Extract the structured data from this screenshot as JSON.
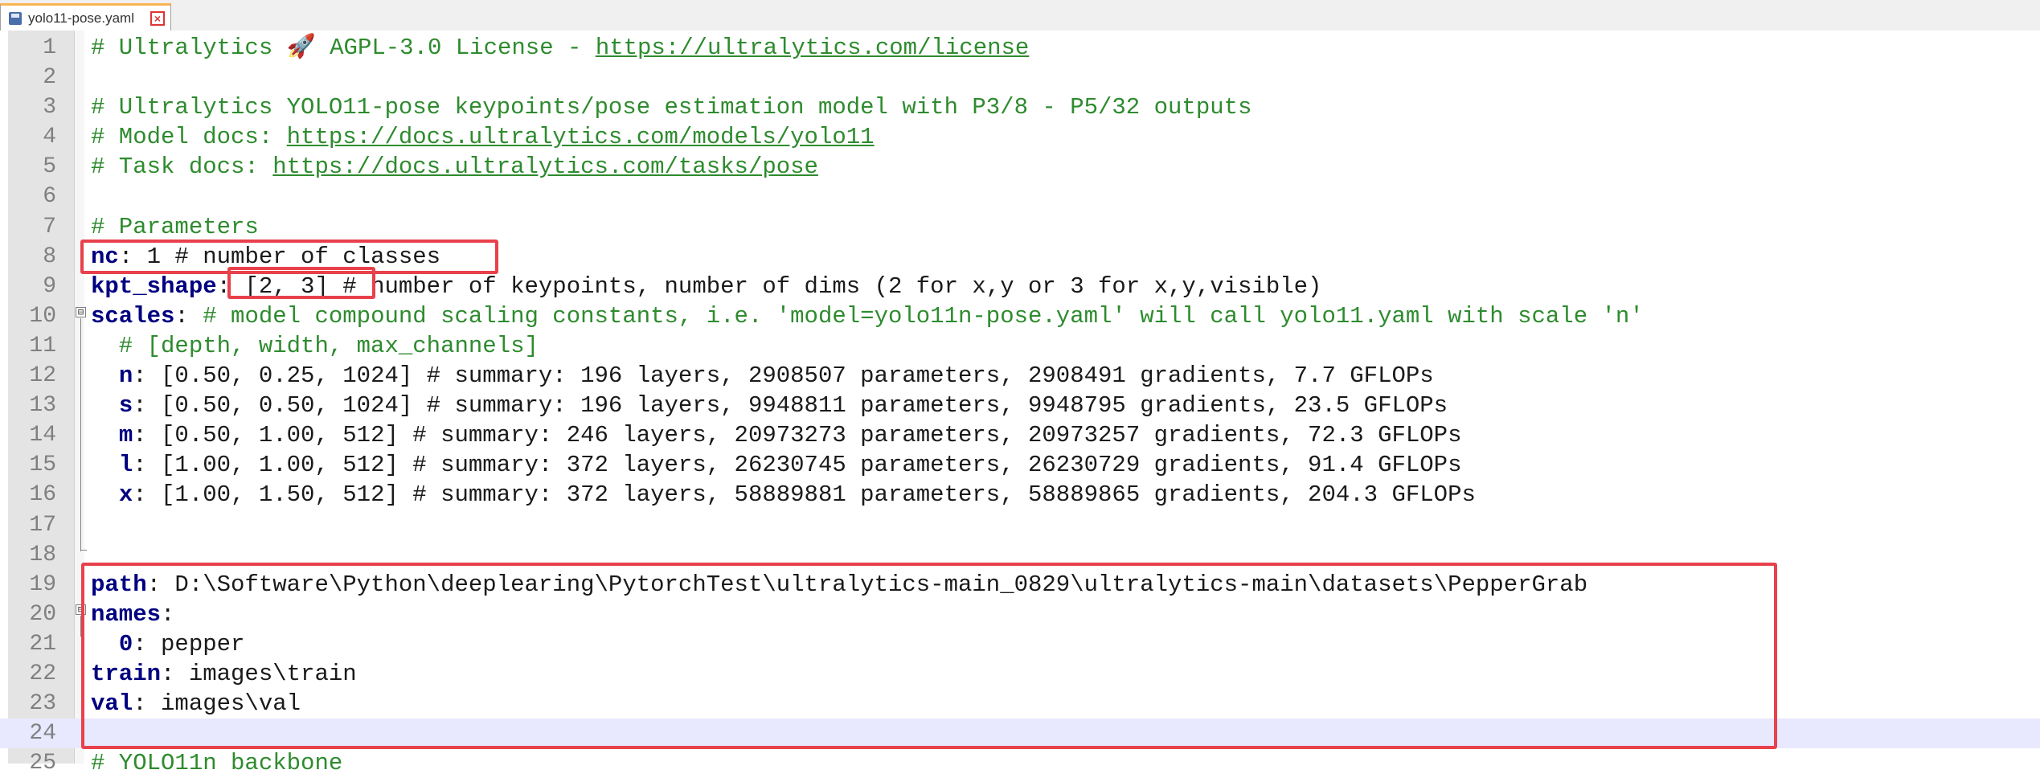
{
  "tab": {
    "label": "yolo11-pose.yaml",
    "close": "×"
  },
  "lines": [
    {
      "n": "1",
      "parts": [
        {
          "t": "# Ultralytics 🚀 AGPL-3.0 License - ",
          "c": "comment"
        },
        {
          "t": "https://ultralytics.com/license",
          "c": "url"
        }
      ]
    },
    {
      "n": "2",
      "parts": []
    },
    {
      "n": "3",
      "parts": [
        {
          "t": "# Ultralytics YOLO11-pose keypoints/pose estimation model with P3/8 - P5/32 outputs",
          "c": "comment"
        }
      ]
    },
    {
      "n": "4",
      "parts": [
        {
          "t": "# Model docs: ",
          "c": "comment"
        },
        {
          "t": "https://docs.ultralytics.com/models/yolo11",
          "c": "url"
        }
      ]
    },
    {
      "n": "5",
      "parts": [
        {
          "t": "# Task docs: ",
          "c": "comment"
        },
        {
          "t": "https://docs.ultralytics.com/tasks/pose",
          "c": "url"
        }
      ]
    },
    {
      "n": "6",
      "parts": []
    },
    {
      "n": "7",
      "parts": [
        {
          "t": "# Parameters",
          "c": "comment"
        }
      ]
    },
    {
      "n": "8",
      "parts": [
        {
          "t": "nc",
          "c": "key"
        },
        {
          "t": ": 1 # number of classes",
          "c": "plain"
        }
      ]
    },
    {
      "n": "9",
      "parts": [
        {
          "t": "kpt_shape",
          "c": "key"
        },
        {
          "t": ": [2, 3] # number of keypoints, number of dims (2 for x,y or 3 for x,y,visible)",
          "c": "plain"
        }
      ]
    },
    {
      "n": "10",
      "parts": [
        {
          "t": "scales",
          "c": "key"
        },
        {
          "t": ": ",
          "c": "plain"
        },
        {
          "t": "# model compound scaling constants, i.e. 'model=yolo11n-pose.yaml' will call yolo11.yaml with scale 'n'",
          "c": "comment"
        }
      ]
    },
    {
      "n": "11",
      "parts": [
        {
          "t": "  # [depth, width, max_channels]",
          "c": "comment"
        }
      ]
    },
    {
      "n": "12",
      "parts": [
        {
          "t": "  ",
          "c": "plain"
        },
        {
          "t": "n",
          "c": "key"
        },
        {
          "t": ": [0.50, 0.25, 1024] # summary: 196 layers, 2908507 parameters, 2908491 gradients, 7.7 GFLOPs",
          "c": "plain"
        }
      ]
    },
    {
      "n": "13",
      "parts": [
        {
          "t": "  ",
          "c": "plain"
        },
        {
          "t": "s",
          "c": "key"
        },
        {
          "t": ": [0.50, 0.50, 1024] # summary: 196 layers, 9948811 parameters, 9948795 gradients, 23.5 GFLOPs",
          "c": "plain"
        }
      ]
    },
    {
      "n": "14",
      "parts": [
        {
          "t": "  ",
          "c": "plain"
        },
        {
          "t": "m",
          "c": "key"
        },
        {
          "t": ": [0.50, 1.00, 512] # summary: 246 layers, 20973273 parameters, 20973257 gradients, 72.3 GFLOPs",
          "c": "plain"
        }
      ]
    },
    {
      "n": "15",
      "parts": [
        {
          "t": "  ",
          "c": "plain"
        },
        {
          "t": "l",
          "c": "key"
        },
        {
          "t": ": [1.00, 1.00, 512] # summary: 372 layers, 26230745 parameters, 26230729 gradients, 91.4 GFLOPs",
          "c": "plain"
        }
      ]
    },
    {
      "n": "16",
      "parts": [
        {
          "t": "  ",
          "c": "plain"
        },
        {
          "t": "x",
          "c": "key"
        },
        {
          "t": ": [1.00, 1.50, 512] # summary: 372 layers, 58889881 parameters, 58889865 gradients, 204.3 GFLOPs",
          "c": "plain"
        }
      ]
    },
    {
      "n": "17",
      "parts": []
    },
    {
      "n": "18",
      "parts": []
    },
    {
      "n": "19",
      "parts": [
        {
          "t": "path",
          "c": "key"
        },
        {
          "t": ": D:\\Software\\Python\\deeplearing\\PytorchTest\\ultralytics-main_0829\\ultralytics-main\\datasets\\PepperGrab",
          "c": "plain"
        }
      ]
    },
    {
      "n": "20",
      "parts": [
        {
          "t": "names",
          "c": "key"
        },
        {
          "t": ":",
          "c": "plain"
        }
      ]
    },
    {
      "n": "21",
      "parts": [
        {
          "t": "  ",
          "c": "plain"
        },
        {
          "t": "0",
          "c": "key"
        },
        {
          "t": ": pepper",
          "c": "plain"
        }
      ]
    },
    {
      "n": "22",
      "parts": [
        {
          "t": "train",
          "c": "key"
        },
        {
          "t": ": images\\train",
          "c": "plain"
        }
      ]
    },
    {
      "n": "23",
      "parts": [
        {
          "t": "val",
          "c": "key"
        },
        {
          "t": ": images\\val",
          "c": "plain"
        }
      ]
    },
    {
      "n": "24",
      "parts": [],
      "current": true
    },
    {
      "n": "25",
      "parts": [
        {
          "t": "# YOLO11n backbone",
          "c": "comment"
        }
      ]
    }
  ],
  "fold_markers": [
    "⊟",
    "⊟"
  ]
}
